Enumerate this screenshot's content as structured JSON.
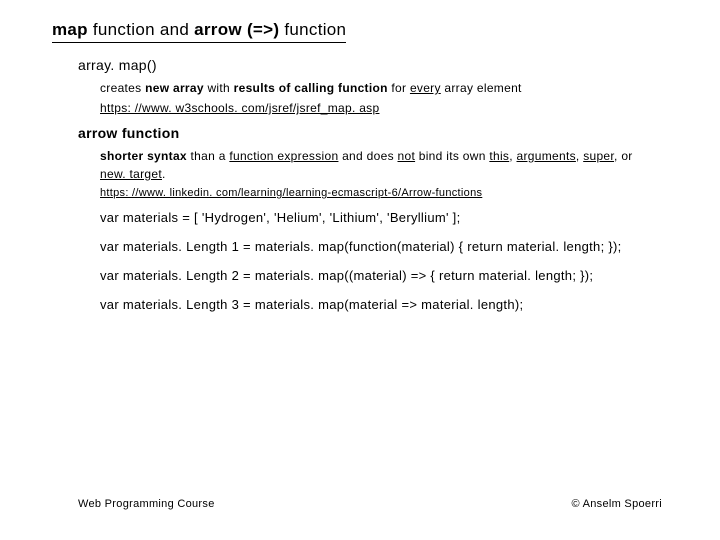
{
  "title": {
    "p1": "map",
    "p2": " function and ",
    "p3": "arrow (=>)",
    "p4": " function"
  },
  "arraymap": {
    "heading": "array. map()",
    "desc": {
      "t1": "creates ",
      "t2": "new array",
      "t3": " with ",
      "t4": "results of calling function",
      "t5": " for ",
      "t6": "every",
      "t7": " array element"
    },
    "link": "https: //www. w3schools. com/jsref/jsref_map. asp"
  },
  "arrow": {
    "heading": "arrow function",
    "desc": {
      "t1": "shorter syntax",
      "t2": " than a ",
      "t3": "function expression",
      "t4": " and does ",
      "t5": "not",
      "t6": " bind its own ",
      "t7": "this",
      "t8": ", ",
      "t9": "arguments",
      "t10": ", ",
      "t11": "super",
      "t12": ", or ",
      "t13": "new. target",
      "t14": "."
    },
    "link": "https: //www. linkedin. com/learning/learning-ecmascript-6/Arrow-functions"
  },
  "code": {
    "line1": "var materials = [ 'Hydrogen', 'Helium', 'Lithium', 'Beryllium' ];",
    "line2": "var materials. Length 1 = materials. map(function(material) { return material. length; });",
    "line3": "var materials. Length 2 = materials. map((material) => { return material. length; });",
    "line4": "var materials. Length 3 = materials. map(material => material. length);"
  },
  "footer": {
    "left": "Web Programming Course",
    "right": "© Anselm Spoerri"
  }
}
